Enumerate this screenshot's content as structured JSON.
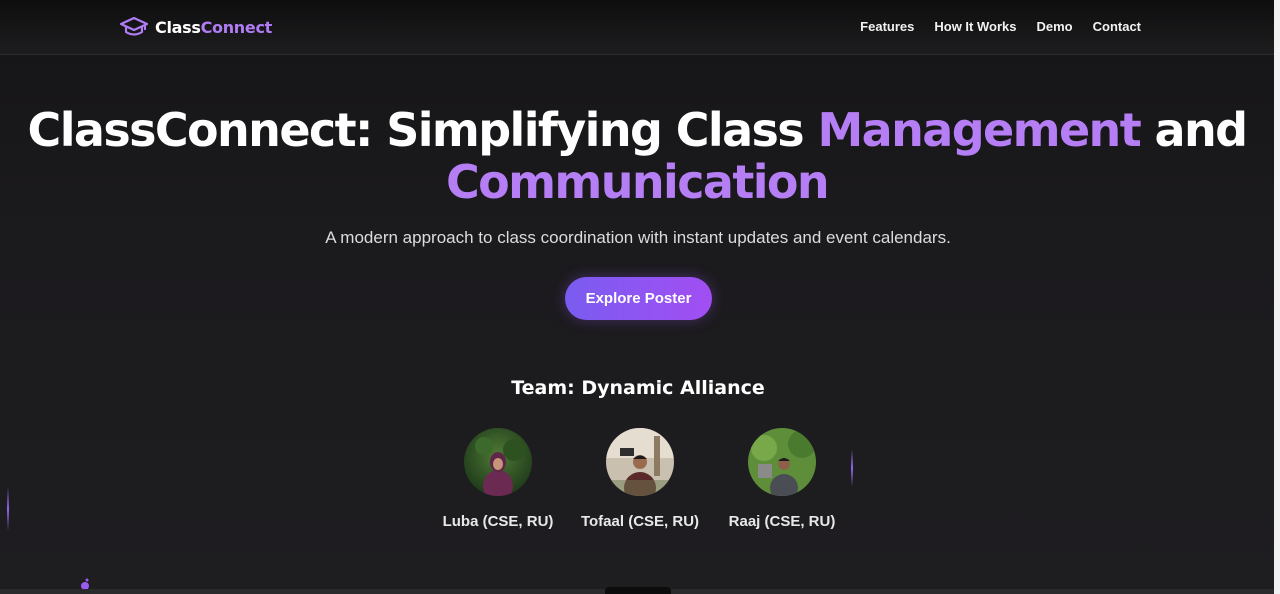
{
  "brand": {
    "name_part1": "Class",
    "name_part2": "Connect",
    "icon": "graduation-cap-icon",
    "accent_color": "#b07cf3"
  },
  "nav": {
    "links": [
      {
        "label": "Features"
      },
      {
        "label": "How It Works"
      },
      {
        "label": "Demo"
      },
      {
        "label": "Contact"
      }
    ]
  },
  "hero": {
    "title_part1": "ClassConnect: Simplifying Class ",
    "title_accent1": "Management",
    "title_part2": " and",
    "title_accent2": "Communication",
    "subtitle": "A modern approach to class coordination with instant updates and event calendars.",
    "cta_label": "Explore Poster",
    "cta_gradient": [
      "#7a5cf0",
      "#a24ef3"
    ]
  },
  "team": {
    "title": "Team: Dynamic Alliance",
    "members": [
      {
        "name": "Luba (CSE, RU)"
      },
      {
        "name": "Tofaal (CSE, RU)"
      },
      {
        "name": "Raaj (CSE, RU)"
      }
    ]
  },
  "colors": {
    "background": "#1c1b1e",
    "accent": "#b57ef5",
    "text": "#ffffff"
  }
}
